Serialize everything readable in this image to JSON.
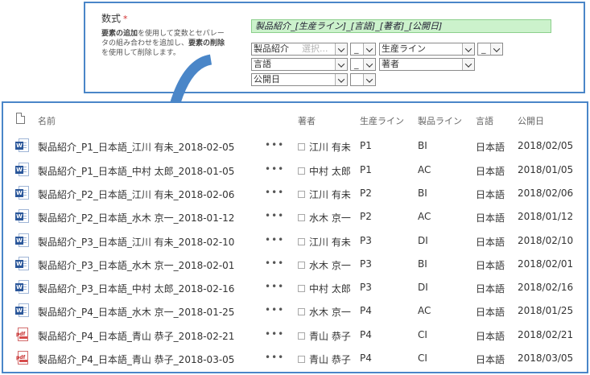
{
  "formula": {
    "label": "数式",
    "required_mark": "*",
    "description_parts": [
      {
        "bold": "要素の追加",
        "text": "を使用して変数とセパレータの組み合わせを追加し、"
      },
      {
        "bold": "要素の削除",
        "text": "を使用して削除します。"
      }
    ],
    "value": "製品紹介_[生産ライン]_[言語]_[著者]_[公開日]",
    "row1": {
      "first": "製品紹介",
      "first_placeholder": "選択...",
      "sep1": "_",
      "field2": "生産ライン",
      "sep2": "_"
    },
    "row2": {
      "field1": "言語",
      "sep1": "_",
      "field2": "著者"
    },
    "row3": {
      "field1": "公開日",
      "sep1": ""
    }
  },
  "library": {
    "columns": {
      "name": "名前",
      "author": "著者",
      "line": "生産ライン",
      "product": "製品ライン",
      "language": "言語",
      "date": "公開日"
    },
    "more_label": "•••",
    "rows": [
      {
        "type": "word",
        "icon": "W",
        "name": "製品紹介_P1_日本語_江川 有未_2018-02-05",
        "author": "江川 有未",
        "line": "P1",
        "product": "BI",
        "language": "日本語",
        "date": "2018/02/05"
      },
      {
        "type": "word",
        "icon": "W",
        "name": "製品紹介_P1_日本語_中村 太郎_2018-01-05",
        "author": "中村 太郎",
        "line": "P1",
        "product": "AC",
        "language": "日本語",
        "date": "2018/01/05"
      },
      {
        "type": "word",
        "icon": "W",
        "name": "製品紹介_P2_日本語_江川 有未_2018-02-06",
        "author": "江川 有未",
        "line": "P2",
        "product": "BI",
        "language": "日本語",
        "date": "2018/02/06"
      },
      {
        "type": "word",
        "icon": "W",
        "name": "製品紹介_P2_日本語_水木 京一_2018-01-12",
        "author": "水木 京一",
        "line": "P2",
        "product": "AC",
        "language": "日本語",
        "date": "2018/01/12"
      },
      {
        "type": "word",
        "icon": "W",
        "name": "製品紹介_P3_日本語_江川 有未_2018-02-10",
        "author": "江川 有未",
        "line": "P3",
        "product": "DI",
        "language": "日本語",
        "date": "2018/02/10"
      },
      {
        "type": "word",
        "icon": "W",
        "name": "製品紹介_P3_日本語_水木 京一_2018-02-01",
        "author": "水木 京一",
        "line": "P3",
        "product": "BI",
        "language": "日本語",
        "date": "2018/02/01"
      },
      {
        "type": "word",
        "icon": "W",
        "name": "製品紹介_P3_日本語_中村 太郎_2018-02-16",
        "author": "中村 太郎",
        "line": "P3",
        "product": "DI",
        "language": "日本語",
        "date": "2018/02/16"
      },
      {
        "type": "word",
        "icon": "W",
        "name": "製品紹介_P4_日本語_水木 京一_2018-01-25",
        "author": "水木 京一",
        "line": "P4",
        "product": "AC",
        "language": "日本語",
        "date": "2018/01/25"
      },
      {
        "type": "pdf",
        "icon": "pdf",
        "name": "製品紹介_P4_日本語_青山 恭子_2018-02-21",
        "author": "青山 恭子",
        "line": "P4",
        "product": "CI",
        "language": "日本語",
        "date": "2018/02/21"
      },
      {
        "type": "pdf",
        "icon": "pdf",
        "name": "製品紹介_P4_日本語_青山 恭子_2018-03-05",
        "author": "青山 恭子",
        "line": "P4",
        "product": "CI",
        "language": "日本語",
        "date": "2018/03/05"
      }
    ]
  },
  "colors": {
    "panel_border": "#4a86c8",
    "arrow": "#4a86c8",
    "formula_bg": "#ccf2cc",
    "word_blue": "#2b579a",
    "pdf_red": "#c62828",
    "required": "#d32f2f"
  }
}
